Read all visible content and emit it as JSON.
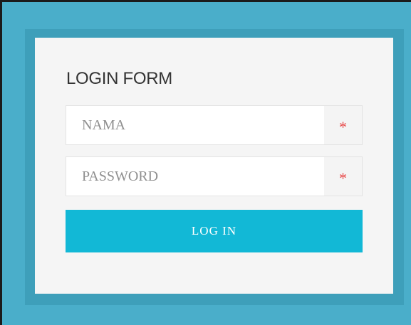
{
  "login_form": {
    "title": "LOGIN FORM",
    "fields": [
      {
        "placeholder": "NAMA",
        "value": "",
        "required_marker": "*"
      },
      {
        "placeholder": "PASSWORD",
        "value": "",
        "required_marker": "*"
      }
    ],
    "submit_label": "LOG IN"
  },
  "colors": {
    "background": "#4aaeca",
    "outer_box": "#3e9fba",
    "card": "#f5f5f5",
    "button": "#12b8d6",
    "required_marker": "#e84a4a"
  }
}
